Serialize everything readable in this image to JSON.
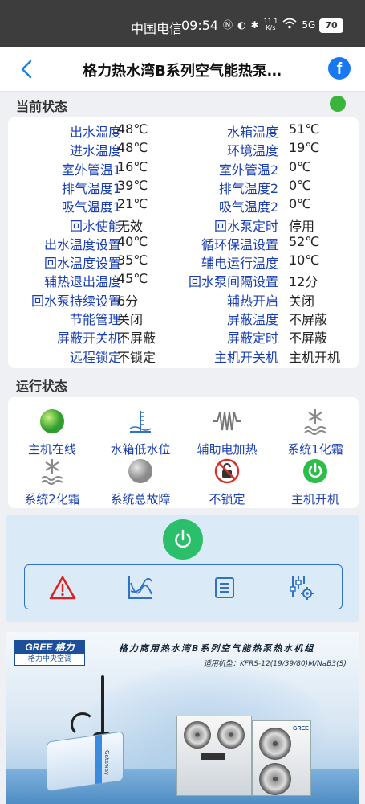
{
  "statusbar": {
    "carrier": "中国电信",
    "time": "09:54",
    "speed_top": "11.1",
    "speed_bottom": "K/s",
    "network": "5G",
    "battery": "70"
  },
  "header": {
    "title": "格力热水湾B系列空气能热泵…",
    "back_icon": "chevron-left-icon",
    "share_icon": "facebook-icon"
  },
  "current_status": {
    "title": "当前状态",
    "indicator_color": "#3cb43c",
    "rows": [
      {
        "label1": "出水温度",
        "value1": "48℃",
        "label2": "水箱温度",
        "value2": "51℃"
      },
      {
        "label1": "进水温度",
        "value1": "48℃",
        "label2": "环境温度",
        "value2": "19℃"
      },
      {
        "label1": "室外管温1",
        "value1": "16℃",
        "label2": "室外管温2",
        "value2": "0℃"
      },
      {
        "label1": "排气温度1",
        "value1": "39℃",
        "label2": "排气温度2",
        "value2": "0℃"
      },
      {
        "label1": "吸气温度1",
        "value1": "21℃",
        "label2": "吸气温度2",
        "value2": "0℃"
      },
      {
        "label1": "回水使能",
        "value1": "无效",
        "label2": "回水泵定时",
        "value2": "停用"
      },
      {
        "label1": "出水温度设置",
        "value1": "40℃",
        "label2": "循环保温设置",
        "value2": "52℃"
      },
      {
        "label1": "回水温度设置",
        "value1": "35℃",
        "label2": "辅电运行温度",
        "value2": "10℃"
      },
      {
        "label1": "辅热退出温度",
        "value1": "45℃",
        "label2": "回水泵间隔设置",
        "value2": "12分"
      },
      {
        "label1": "回水泵持续设置",
        "value1": "6分",
        "label2": "辅热开启",
        "value2": "关闭"
      },
      {
        "label1": "节能管理",
        "value1": "关闭",
        "label2": "屏蔽温度",
        "value2": "不屏蔽"
      },
      {
        "label1": "屏蔽开关机",
        "value1": "不屏蔽",
        "label2": "屏蔽定时",
        "value2": "不屏蔽"
      },
      {
        "label1": "远程锁定",
        "value1": "不锁定",
        "label2": "主机开关机",
        "value2": "主机开机"
      }
    ]
  },
  "run_status": {
    "title": "运行状态",
    "items": [
      {
        "label": "主机在线",
        "icon": "online-green-dot-icon"
      },
      {
        "label": "水箱低水位",
        "icon": "water-tank-level-icon"
      },
      {
        "label": "辅助电加热",
        "icon": "electric-heater-icon"
      },
      {
        "label": "系统1化霜",
        "icon": "defrost-snowflake-icon"
      },
      {
        "label": "系统2化霜",
        "icon": "defrost-snowflake-icon"
      },
      {
        "label": "系统总故障",
        "icon": "fault-gray-dot-icon"
      },
      {
        "label": "不锁定",
        "icon": "unlocked-icon"
      },
      {
        "label": "主机开机",
        "icon": "power-on-icon"
      }
    ]
  },
  "controls": {
    "power_icon": "power-icon",
    "tools": [
      {
        "name": "alarm",
        "icon": "warning-triangle-icon"
      },
      {
        "name": "curve",
        "icon": "line-chart-icon"
      },
      {
        "name": "records",
        "icon": "list-document-icon"
      },
      {
        "name": "settings",
        "icon": "sliders-settings-icon"
      }
    ],
    "colors": {
      "power": "#2bbf6c",
      "alarm": "#e02020",
      "tool": "#2f72c6"
    }
  },
  "banner": {
    "brand_top": "GREE 格力",
    "brand_bottom": "格力中央空调",
    "title": "格力商用热水湾B系列空气能热泵热水机组",
    "subtitle": "适用机型：KFRS-12(19/39/80)M/NaB3(S)",
    "gateway_text": "Gateway",
    "unit_brand": "GREE"
  }
}
